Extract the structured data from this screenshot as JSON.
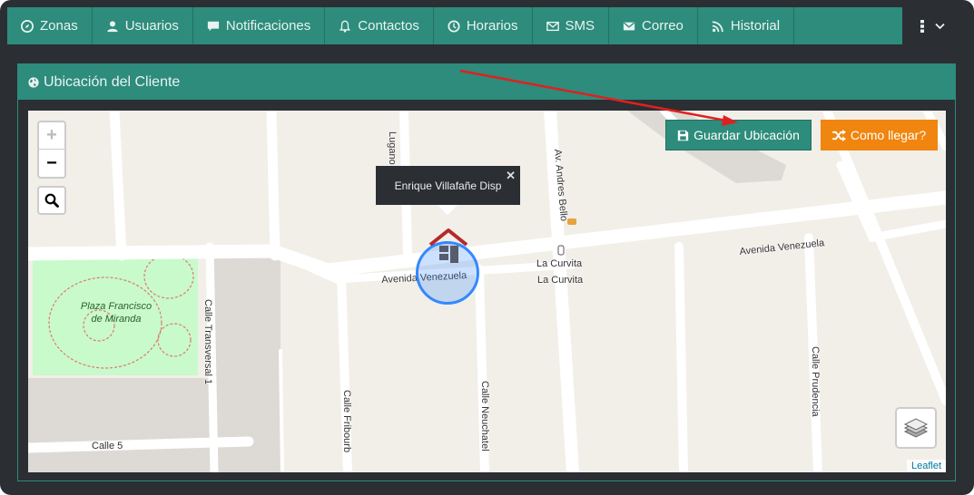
{
  "nav": {
    "items": [
      {
        "label": "Zonas",
        "icon": "compass-icon"
      },
      {
        "label": "Usuarios",
        "icon": "user-icon"
      },
      {
        "label": "Notificaciones",
        "icon": "comment-icon"
      },
      {
        "label": "Contactos",
        "icon": "bell-icon"
      },
      {
        "label": "Horarios",
        "icon": "clock-icon"
      },
      {
        "label": "SMS",
        "icon": "envelope-outline-icon"
      },
      {
        "label": "Correo",
        "icon": "envelope-icon"
      },
      {
        "label": "Historial",
        "icon": "rss-icon"
      }
    ],
    "more_icon": "kebab-menu-icon"
  },
  "panel": {
    "title": "Ubicación del Cliente",
    "title_icon": "globe-icon"
  },
  "map": {
    "save_button": "Guardar Ubicación",
    "route_button": "Como llegar?",
    "zoom_in": "+",
    "zoom_out": "−",
    "popup_text": "Enrique Villafañe Disp",
    "popup_close": "✕",
    "attribution": "Leaflet",
    "park_label": "Plaza Francisco de Miranda",
    "streets": {
      "lugano": "Lugano",
      "andres_bello": "Av. Andres Bello",
      "venezuela_east": "Avenida Venezuela",
      "venezuela_west": "Avenida Venezuela",
      "curvita_1": "La Curvita",
      "curvita_2": "La Curvita",
      "transversal": "Calle Transversal 1",
      "fribourb": "Calle Fribourb",
      "neuchatel": "Calle Neuchatel",
      "prudencia": "Calle Prudencia",
      "calle5": "Calle 5"
    }
  },
  "colors": {
    "brand": "#2d8c7b",
    "accent_orange": "#f0850f",
    "dark_bg": "#2b2e33",
    "arrow": "#e02020"
  }
}
